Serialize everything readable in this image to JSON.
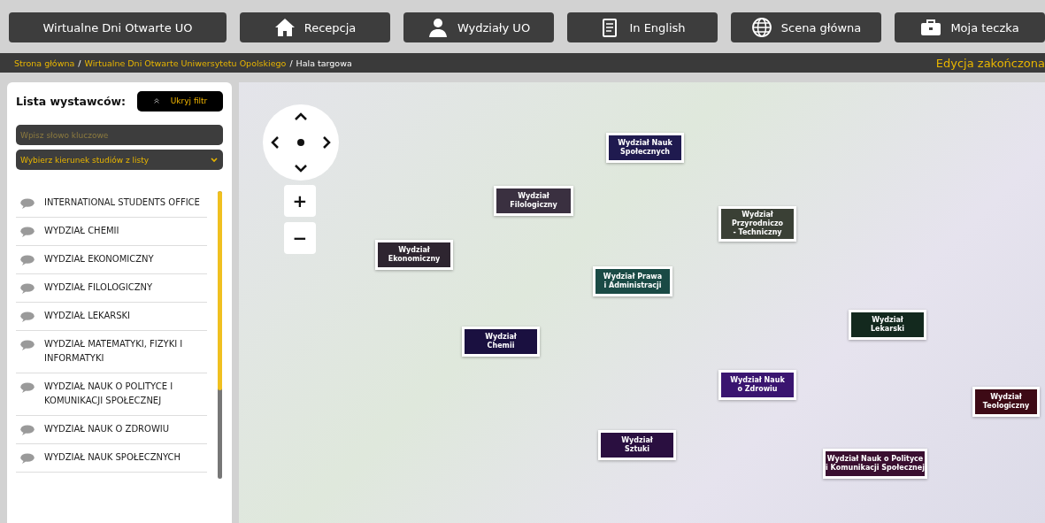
{
  "nav": [
    {
      "label": "Wirtualne Dni Otwarte UO",
      "kind": "text"
    },
    {
      "label": "Recepcja",
      "kind": "house"
    },
    {
      "label": "Wydziały UO",
      "kind": "person"
    },
    {
      "label": "In English",
      "kind": "document"
    },
    {
      "label": "Scena główna",
      "kind": "globe"
    },
    {
      "label": "Moja teczka",
      "kind": "briefcase"
    }
  ],
  "breadcrumb": {
    "separator": "/",
    "links": [
      "Strona główna",
      "Wirtualne Dni Otwarte Uniwersytetu Opolskiego"
    ],
    "current": "Hala targowa",
    "status": "Edycja zakończona"
  },
  "sidebar": {
    "title": "Lista wystawców:",
    "hide_button": "Ukryj filtr",
    "search": {
      "placeholder": "Wpisz słowo kluczowe"
    },
    "select": {
      "value": "Wybierz kierunek studiów z listy"
    },
    "items": [
      "INTERNATIONAL STUDENTS OFFICE",
      "WYDZIAŁ CHEMII",
      "WYDZIAŁ EKONOMICZNY",
      "WYDZIAŁ FILOLOGICZNY",
      "WYDZIAŁ LEKARSKI",
      "WYDZIAŁ MATEMATYKI, FIZYKI I INFORMATYKI",
      "WYDZIAŁ NAUK O POLITYCE I KOMUNIKACJI SPOŁECZNEJ",
      "WYDZIAŁ NAUK O ZDROWIU",
      "WYDZIAŁ NAUK SPOŁECZNYCH"
    ]
  },
  "map": {
    "zoom_in": "+",
    "zoom_out": "−",
    "labels": [
      {
        "lines": [
          "Wydział Nauk",
          "Społecznych"
        ],
        "color": "#1f1a4f"
      },
      {
        "lines": [
          "Wydział",
          "Filologiczny"
        ],
        "color": "#3a3040"
      },
      {
        "lines": [
          "Wydział",
          "Przyrodniczo",
          "- Techniczny"
        ],
        "color": "#3a4035"
      },
      {
        "lines": [
          "Wydział",
          "Ekonomiczny"
        ],
        "color": "#2e2530"
      },
      {
        "lines": [
          "Wydział Prawa",
          "i Administracji"
        ],
        "color": "#1a4a45"
      },
      {
        "lines": [
          "Wydział",
          "Chemii"
        ],
        "color": "#1a1040"
      },
      {
        "lines": [
          "Wydział",
          "Lekarski"
        ],
        "color": "#13291e"
      },
      {
        "lines": [
          "Wydział Nauk",
          "o Zdrowiu"
        ],
        "color": "#3a1570"
      },
      {
        "lines": [
          "Wydział",
          "Teologiczny"
        ],
        "color": "#3d0a15"
      },
      {
        "lines": [
          "Wydział",
          "Sztuki"
        ],
        "color": "#2a0f40"
      },
      {
        "lines": [
          "Wydział Nauk o Polityce",
          "i Komunikacji Społecznej"
        ],
        "color": "#3a0f30"
      }
    ]
  }
}
